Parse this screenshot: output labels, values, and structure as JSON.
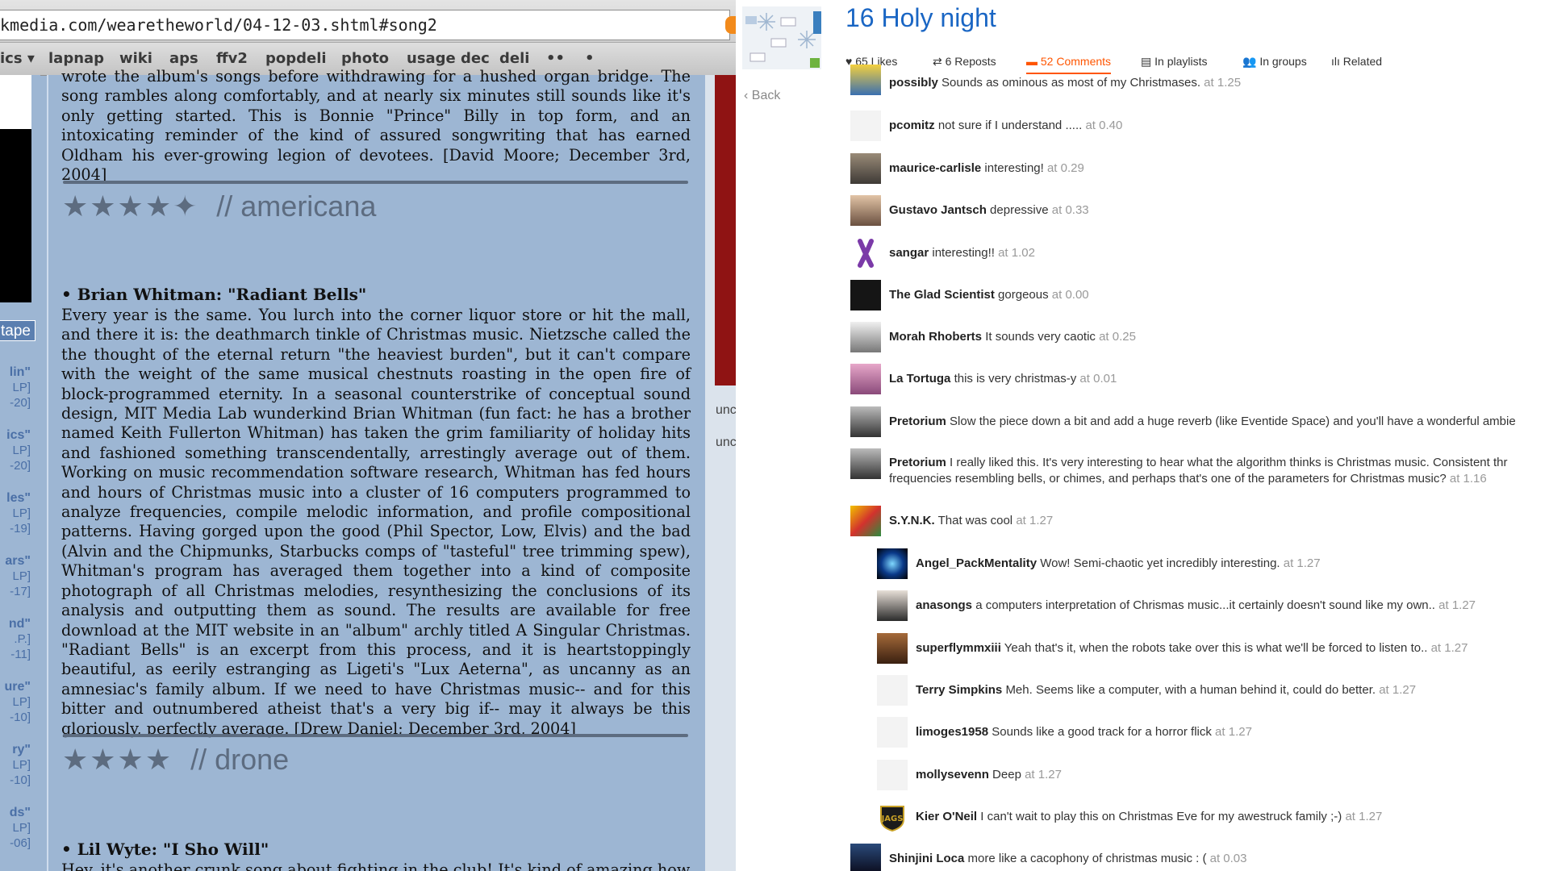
{
  "left_browser": {
    "url": "kmedia.com/wearetheworld/04-12-03.shtml#song2",
    "bookmarks": [
      "ics ▾",
      "lapnap",
      "wiki",
      "aps",
      "ffv2",
      "popdeli",
      "photo",
      "usage dec",
      "deli",
      "••",
      "•"
    ],
    "sidebar": {
      "tab_label": "tape",
      "entries": [
        {
          "title": "lin\"",
          "sub1": "LP]",
          "sub2": "-20]"
        },
        {
          "title": "ics\"",
          "sub1": "LP]",
          "sub2": "-20]"
        },
        {
          "title": "les\"",
          "sub1": "LP]",
          "sub2": "-19]"
        },
        {
          "title": "ars\"",
          "sub1": "LP]",
          "sub2": "-17]"
        },
        {
          "title": "nd\"",
          "sub1": ".P.]",
          "sub2": "-11]"
        },
        {
          "title": "ure\"",
          "sub1": "LP]",
          "sub2": "-10]"
        },
        {
          "title": "ry\"",
          "sub1": "LP]",
          "sub2": "-10]"
        },
        {
          "title": "ds\"",
          "sub1": "LP]",
          "sub2": "-06]"
        }
      ]
    },
    "reviews": {
      "first_tail": "wrote the album's songs before withdrawing for a hushed organ bridge. The song rambles along comfortably, and at nearly six minutes still sounds like it's only getting started. This is Bonnie \"Prince\" Billy in top form, and an intoxicating reminder of the kind of assured songwriting that has earned Oldham his ever-growing legion of devotees. [David Moore; December 3rd, 2004]",
      "first_rating": "★★★★✦",
      "first_genre": "// americana",
      "second_title": "• Brian Whitman: \"Radiant Bells\"",
      "second_body": "Every year is the same. You lurch into the corner liquor store or hit the mall, and there it is: the deathmarch tinkle of Christmas music. Nietzsche called the the thought of the eternal return \"the heaviest burden\", but it can't compare with the weight of the same musical chestnuts roasting in the open fire of block-programmed eternity. In a seasonal counterstrike of conceptual sound design, MIT Media Lab wunderkind Brian Whitman (fun fact: he has a brother named Keith Fullerton Whitman) has taken the grim familiarity of holiday hits and fashioned something transcendentally, arrestingly average out of them. Working on music recommendation software research, Whitman has fed hours and hours of Christmas music into a cluster of 16 computers programmed to analyze frequencies, compile melodic information, and profile compositional patterns. Having gorged upon the good (Phil Spector, Low, Elvis) and the bad (Alvin and the Chipmunks, Starbucks comps of \"tasteful\" tree trimming spew), Whitman's program has averaged them together into a kind of composite photograph of all Christmas melodies, resynthesizing the conclusions of its analysis and outputting them as sound. The results are available for free download at the MIT website in an \"album\" archly titled A Singular Christmas. \"Radiant Bells\" is an excerpt from this process, and it is heartstoppingly beautiful, as eerily estranging as Ligeti's \"Lux Aeterna\", as uncanny as an amnesiac's family album. If we need to have Christmas music-- and for this bitter and outnumbered atheist that's a very big if-- may it always be this gloriously, perfectly average. [Drew Daniel; December 3rd, 2004]",
      "second_rating": "★★★★",
      "second_genre": "// drone",
      "third_title": "• Lil Wyte: \"I Sho Will\"",
      "third_body": "Hey, it's another crunk song about fighting in the club! It's kind of amazing how"
    },
    "strip_texts": [
      "unc",
      "unc"
    ]
  },
  "right_browser": {
    "back_label": "Back",
    "track_title": "16 Holy night",
    "stats": [
      {
        "icon": "heart-icon",
        "label": "65 Likes"
      },
      {
        "icon": "repost-icon",
        "label": "6 Reposts"
      },
      {
        "icon": "comment-icon",
        "label": "52 Comments"
      },
      {
        "icon": "playlist-icon",
        "label": "In playlists"
      },
      {
        "icon": "groups-icon",
        "label": "In groups"
      },
      {
        "icon": "related-icon",
        "label": "Related"
      }
    ],
    "accent_color": "#ff5500",
    "title_color": "#1a66c4",
    "comments": [
      {
        "user": "possibly",
        "text": "Sounds as ominous as most of my Christmases.",
        "time": "at 1.25"
      },
      {
        "user": "pcomitz",
        "text": "not sure if I understand .....",
        "time": "at 0.40"
      },
      {
        "user": "maurice-carlisle",
        "text": "interesting!",
        "time": "at 0.29"
      },
      {
        "user": "Gustavo Jantsch",
        "text": "depressive",
        "time": "at 0.33"
      },
      {
        "user": "sangar",
        "text": "interesting!!",
        "time": "at 1.02"
      },
      {
        "user": "The Glad Scientist",
        "text": "gorgeous",
        "time": "at 0.00"
      },
      {
        "user": "Morah Rhoberts",
        "text": "It sounds very caotic",
        "time": "at 0.25"
      },
      {
        "user": "La Tortuga",
        "text": "this is very christmas-y",
        "time": "at 0.01"
      },
      {
        "user": "Pretorium",
        "text": "Slow the piece down a bit and add a huge reverb (like Eventide Space) and you'll have a wonderful ambie",
        "time": ""
      },
      {
        "user": "Pretorium",
        "text": "I really liked this. It's very interesting to hear what the algorithm thinks is Christmas music. Consistent thr",
        "text2": "frequencies resembling bells, or chimes, and perhaps that's one of the parameters for Christmas music?",
        "time": "at 1.16"
      },
      {
        "user": "S.Y.N.K.",
        "text": "That was cool",
        "time": "at 1.27"
      },
      {
        "user": "Angel_PackMentality",
        "text": "Wow! Semi-chaotic yet incredibly interesting.",
        "time": "at 1.27"
      },
      {
        "user": "anasongs",
        "text": "a computers interpretation of Chrismas music...it certainly doesn't sound like my own..",
        "time": "at 1.27"
      },
      {
        "user": "superflymmxiii",
        "text": "Yeah that's it, when the robots take over this is what we'll be forced to listen to..",
        "time": "at 1.27"
      },
      {
        "user": "Terry Simpkins",
        "text": "Meh. Seems like a computer, with a human behind it, could do better.",
        "time": "at 1.27"
      },
      {
        "user": "limoges1958",
        "text": "Sounds like a good track for a horror flick",
        "time": "at 1.27"
      },
      {
        "user": "mollysevenn",
        "text": "Deep",
        "time": "at 1.27"
      },
      {
        "user": "Kier O'Neil",
        "text": "I can't wait to play this on Christmas Eve for my awestruck family ;-)",
        "time": "at 1.27"
      },
      {
        "user": "Shinjini Loca",
        "text": "more like a cacophony of christmas music : (",
        "time": "at 0.03"
      }
    ],
    "avatar_badge": "JAGS"
  }
}
